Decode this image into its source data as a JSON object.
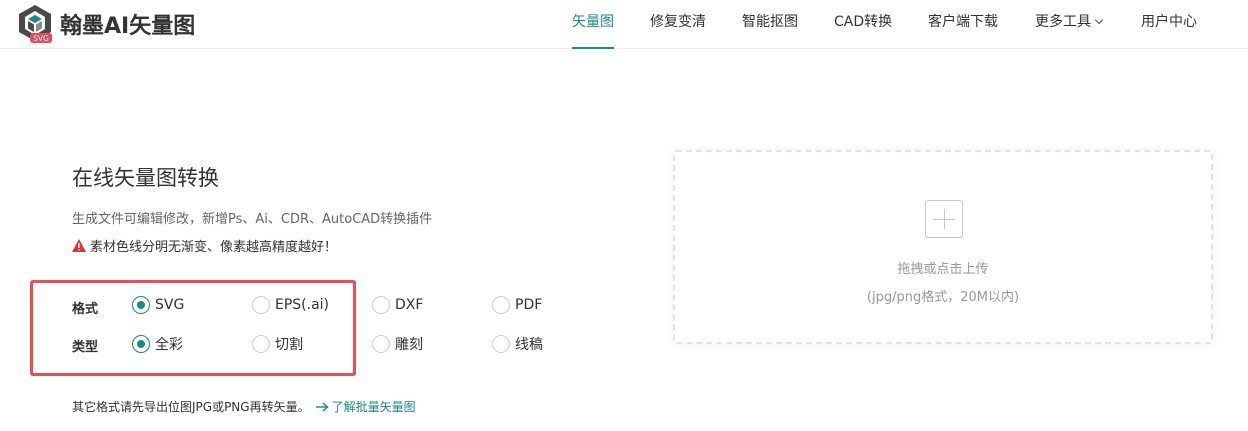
{
  "brand": {
    "name": "翰墨AI矢量图",
    "badge": "SVG"
  },
  "nav": {
    "items": [
      {
        "label": "矢量图",
        "active": true
      },
      {
        "label": "修复变清",
        "active": false
      },
      {
        "label": "智能抠图",
        "active": false
      },
      {
        "label": "CAD转换",
        "active": false
      },
      {
        "label": "客户端下载",
        "active": false
      },
      {
        "label": "更多工具",
        "active": false,
        "dropdown": true
      },
      {
        "label": "用户中心",
        "active": false
      }
    ]
  },
  "main": {
    "title": "在线矢量图转换",
    "subtitle": "生成文件可编辑修改，新增Ps、Ai、CDR、AutoCAD转换插件",
    "warning": "素材色线分明无渐变、像素越高精度越好！",
    "format": {
      "label": "格式",
      "options": [
        {
          "label": "SVG",
          "checked": true
        },
        {
          "label": "EPS(.ai)",
          "checked": false
        },
        {
          "label": "DXF",
          "checked": false
        },
        {
          "label": "PDF",
          "checked": false
        }
      ]
    },
    "type": {
      "label": "类型",
      "options": [
        {
          "label": "全彩",
          "checked": true
        },
        {
          "label": "切割",
          "checked": false
        },
        {
          "label": "雕刻",
          "checked": false
        },
        {
          "label": "线稿",
          "checked": false
        }
      ]
    },
    "note": "其它格式请先导出位图JPG或PNG再转矢量。",
    "note_link": "了解批量矢量图"
  },
  "upload": {
    "title": "拖拽或点击上传",
    "hint": "(jpg/png格式，20M以内)"
  },
  "colors": {
    "accent": "#1a8a8a",
    "highlight_border": "#ea4d56",
    "warning": "#d9363e"
  }
}
